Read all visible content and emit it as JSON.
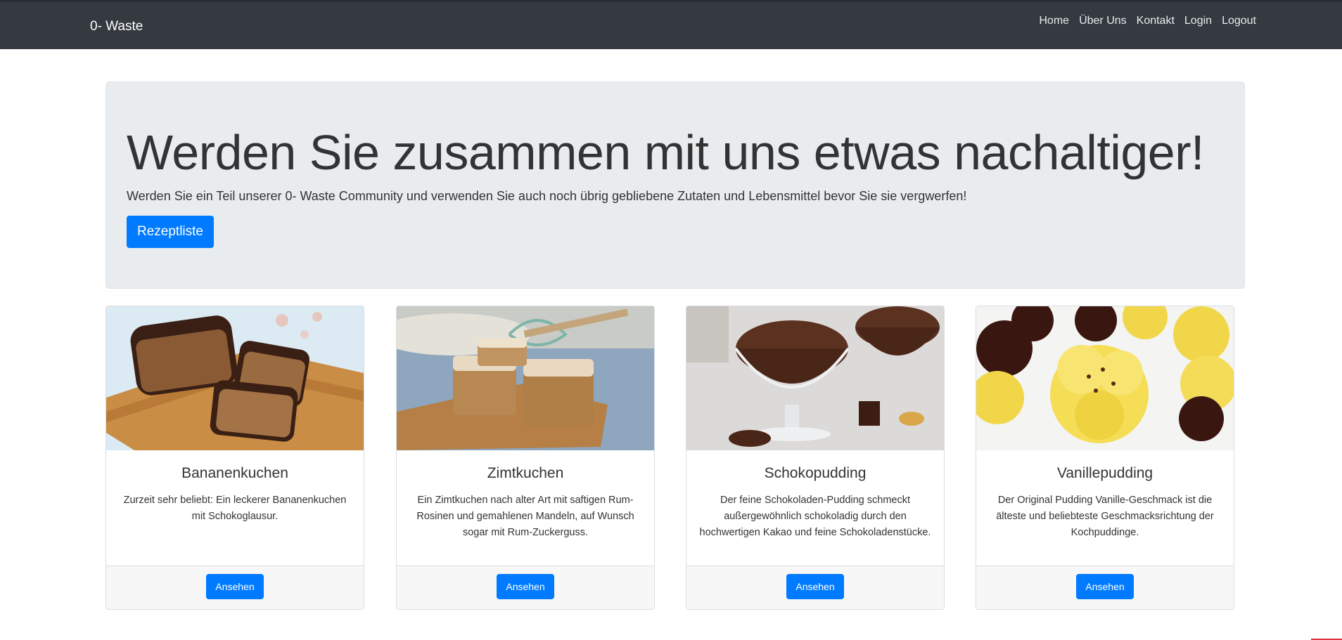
{
  "navbar": {
    "brand": "0- Waste",
    "links": [
      "Home",
      "Über Uns",
      "Kontakt",
      "Login",
      "Logout"
    ]
  },
  "jumbotron": {
    "title": "Werden Sie zusammen mit uns etwas nachaltiger!",
    "lead": "Werden Sie ein Teil unserer 0- Waste Community und verwenden Sie auch noch übrig gebliebene Zutaten und Lebensmittel bevor Sie sie vergwerfen!",
    "button": "Rezeptliste"
  },
  "cards": [
    {
      "title": "Bananenkuchen",
      "text": "Zurzeit sehr beliebt: Ein leckerer Bananenkuchen mit Schokoglausur.",
      "button": "Ansehen"
    },
    {
      "title": "Zimtkuchen",
      "text": "Ein Zimtkuchen nach alter Art mit saftigen Rum-Rosinen und gemahlenen Mandeln, auf Wunsch sogar mit Rum-Zuckerguss.",
      "button": "Ansehen"
    },
    {
      "title": "Schokopudding",
      "text": "Der feine Schokoladen-Pudding schmeckt außergewöhnlich schokoladig durch den hochwertigen Kakao und feine Schokoladenstücke.",
      "button": "Ansehen"
    },
    {
      "title": "Vanillepudding",
      "text": "Der Original Pudding Vanille-Geschmack ist die älteste und beliebteste Geschmacksrichtung der Kochpuddinge.",
      "button": "Ansehen"
    }
  ],
  "colors": {
    "navbar": "#343a40",
    "jumbotron": "#e9ecef",
    "primary": "#007bff"
  }
}
